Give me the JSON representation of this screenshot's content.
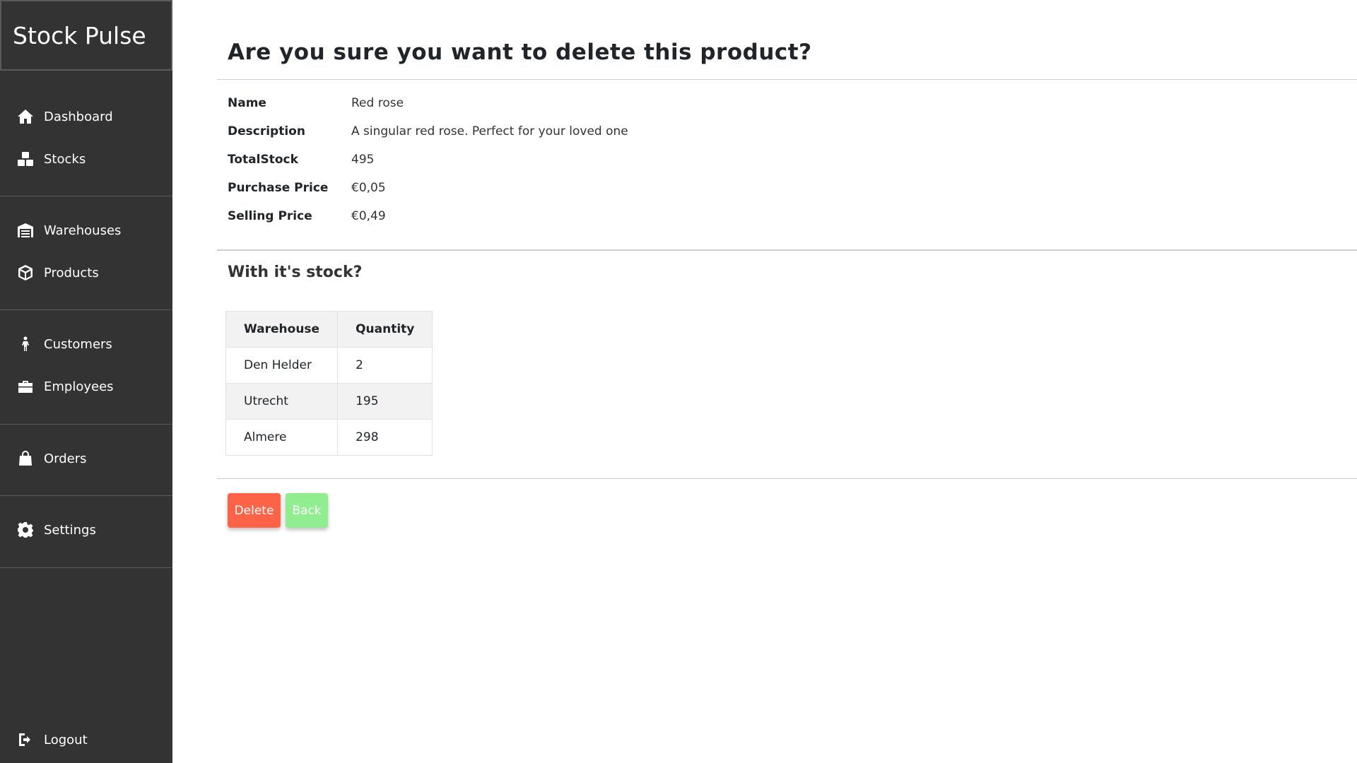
{
  "app": {
    "title": "Stock Pulse"
  },
  "sidebar": {
    "items": [
      {
        "label": "Dashboard",
        "icon": "home-icon"
      },
      {
        "label": "Stocks",
        "icon": "boxes-icon"
      },
      {
        "label": "Warehouses",
        "icon": "warehouse-icon"
      },
      {
        "label": "Products",
        "icon": "cube-icon"
      },
      {
        "label": "Customers",
        "icon": "person-icon"
      },
      {
        "label": "Employees",
        "icon": "briefcase-icon"
      },
      {
        "label": "Orders",
        "icon": "shopping-bag-icon"
      },
      {
        "label": "Settings",
        "icon": "gear-icon"
      },
      {
        "label": "Logout",
        "icon": "logout-icon"
      }
    ]
  },
  "page": {
    "title": "Are you sure you want to delete this product?",
    "details": [
      {
        "term": "Name",
        "value": "Red rose"
      },
      {
        "term": "Description",
        "value": "A singular red rose. Perfect for your loved one"
      },
      {
        "term": "TotalStock",
        "value": "495"
      },
      {
        "term": "Purchase Price",
        "value": "€0,05"
      },
      {
        "term": "Selling Price",
        "value": "€0,49"
      }
    ],
    "stock_question": "With it's stock?",
    "stock_table": {
      "headers": [
        "Warehouse",
        "Quantity"
      ],
      "rows": [
        [
          "Den Helder",
          "2"
        ],
        [
          "Utrecht",
          "195"
        ],
        [
          "Almere",
          "298"
        ]
      ]
    },
    "buttons": {
      "delete": "Delete",
      "back": "Back"
    }
  },
  "colors": {
    "sidebar_bg": "#333333",
    "delete_button": "#ff6347",
    "back_button": "#90ee90"
  }
}
